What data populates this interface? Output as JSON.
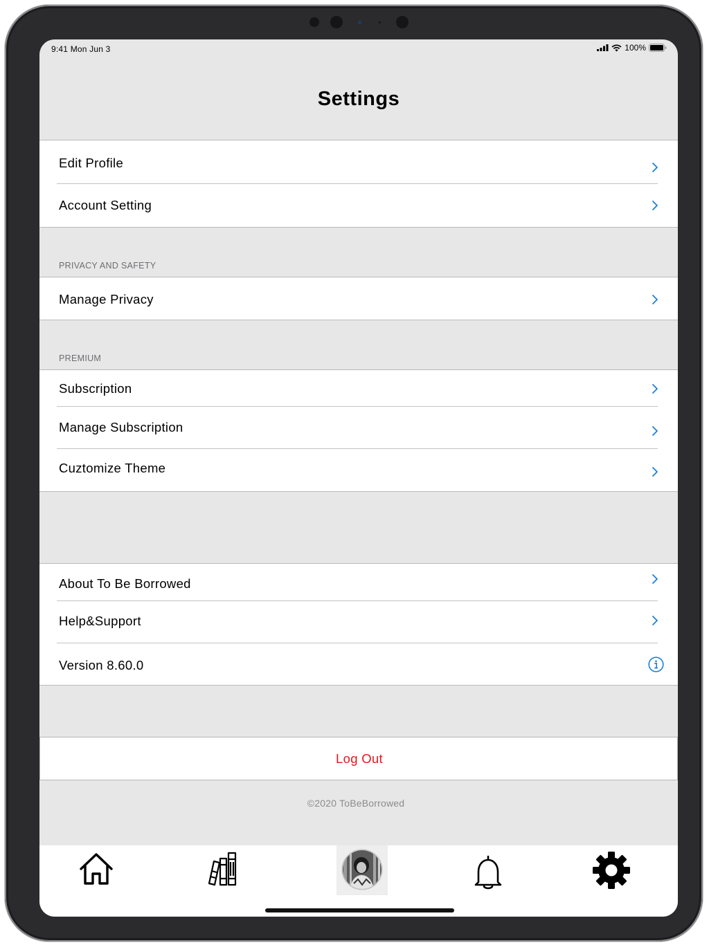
{
  "status_bar": {
    "time": "9:41  Mon Jun 3",
    "battery": "100%"
  },
  "header": {
    "title": "Settings"
  },
  "groups": {
    "account": {
      "items": [
        {
          "label": "Edit Profile"
        },
        {
          "label": "Account Setting"
        }
      ]
    },
    "privacy": {
      "header": "PRIVACY AND SAFETY",
      "items": [
        {
          "label": "Manage Privacy"
        }
      ]
    },
    "premium": {
      "header": "PREMIUM",
      "items": [
        {
          "label": "Subscription"
        },
        {
          "label": "Manage Subscription"
        },
        {
          "label": "Cuztomize Theme"
        }
      ]
    },
    "about": {
      "items": [
        {
          "label": "About To Be Borrowed"
        },
        {
          "label": "Help&Support"
        },
        {
          "label": "Version 8.60.0"
        }
      ]
    }
  },
  "logout": {
    "label": "Log Out"
  },
  "footer": {
    "copyright": "©2020 ToBeBorrowed"
  },
  "tab_bar": {
    "tabs": [
      {
        "icon": "home-icon"
      },
      {
        "icon": "books-icon"
      },
      {
        "icon": "profile-avatar"
      },
      {
        "icon": "bell-icon"
      },
      {
        "icon": "gear-icon"
      }
    ],
    "selected": 4
  },
  "colors": {
    "accent": "#1a7fe0",
    "destructive": "#e0191c",
    "background": "#e7e7e7"
  }
}
